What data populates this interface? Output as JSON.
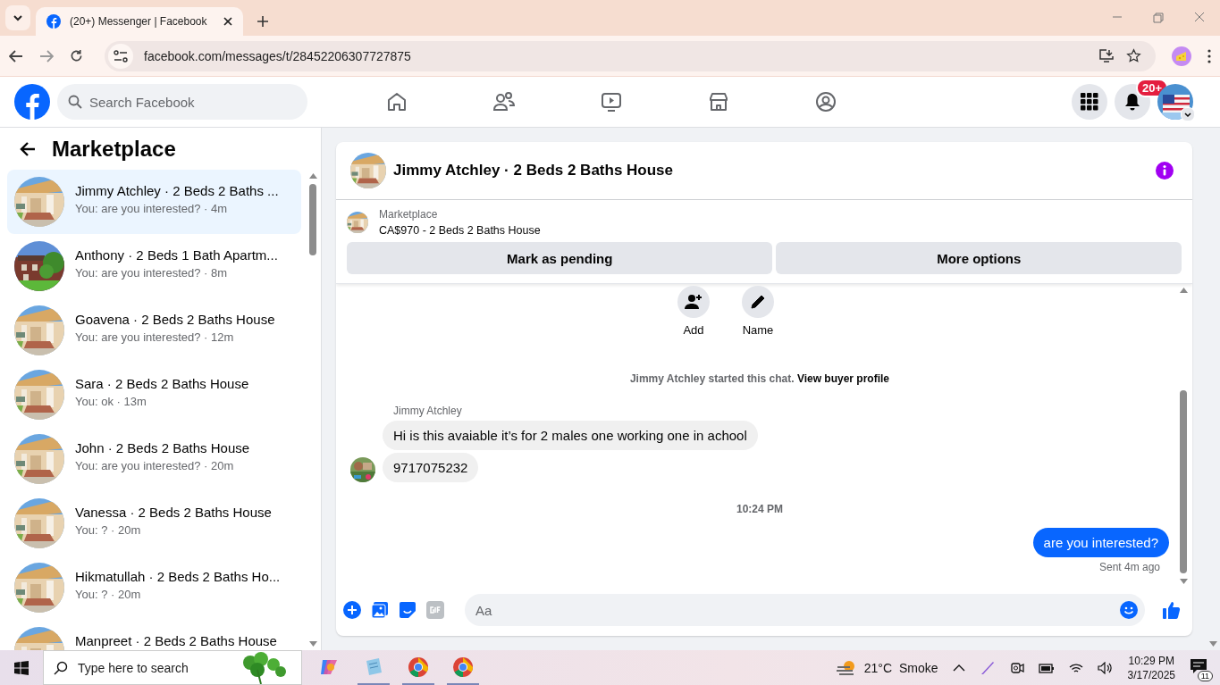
{
  "browser": {
    "tabs": [
      {
        "title": "(20+) Messenger | Facebook",
        "selected": true
      }
    ],
    "url": "facebook.com/messages/t/28452206307727875"
  },
  "header": {
    "search": {
      "placeholder": "Search Facebook"
    },
    "notification_badge": "20+"
  },
  "sidebar": {
    "title": "Marketplace",
    "conversations": [
      {
        "title": "Jimmy Atchley · 2 Beds 2 Baths ...",
        "preview": "You: are you interested? · 4m",
        "selected": true
      },
      {
        "title": "Anthony · 2 Beds 1 Bath Apartm...",
        "preview": "You: are you interested? · 8m",
        "selected": false
      },
      {
        "title": "Goavena · 2 Beds 2 Baths House",
        "preview": "You: are you interested? · 12m",
        "selected": false
      },
      {
        "title": "Sara · 2 Beds 2 Baths House",
        "preview": "You: ok · 13m",
        "selected": false
      },
      {
        "title": "John · 2 Beds 2 Baths House",
        "preview": "You: are you interested? · 20m",
        "selected": false
      },
      {
        "title": "Vanessa · 2 Beds 2 Baths House",
        "preview": "You: ? · 20m",
        "selected": false
      },
      {
        "title": "Hikmatullah · 2 Beds 2 Baths Ho...",
        "preview": "You: ? · 20m",
        "selected": false
      },
      {
        "title": "Manpreet · 2 Beds 2 Baths House",
        "selected": false
      }
    ]
  },
  "chat": {
    "title": "Jimmy Atchley · 2 Beds 2 Baths House",
    "listing": {
      "label": "Marketplace",
      "item": "CA$970 - 2 Beds 2 Baths House"
    },
    "buttons": [
      "Mark as pending",
      "More options"
    ],
    "actions": [
      {
        "kind": "add",
        "label": "Add"
      },
      {
        "kind": "name",
        "label": "Name"
      }
    ],
    "messages": [
      {
        "kind": "system",
        "text": "Jimmy Atchley started this chat.",
        "link": "View buyer profile"
      },
      {
        "kind": "sender",
        "text": "Jimmy Atchley"
      },
      {
        "kind": "incoming",
        "text": "Hi is this avaiable it’s for 2 males one working one in achool",
        "avatar": false
      },
      {
        "kind": "incoming",
        "text": "9717075232",
        "avatar": true
      },
      {
        "kind": "timestamp",
        "text": "10:24 PM"
      },
      {
        "kind": "outgoing",
        "text": "are you  interested?"
      },
      {
        "kind": "status",
        "text": "Sent 4m ago"
      }
    ],
    "composer": {
      "placeholder": "Aa"
    }
  },
  "taskbar": {
    "search": {
      "placeholder": "Type here to search"
    },
    "weather": {
      "temperature": "21°C",
      "condition": "Smoke"
    },
    "time": "10:29 PM",
    "date": "3/17/2025",
    "notifications": "11"
  }
}
